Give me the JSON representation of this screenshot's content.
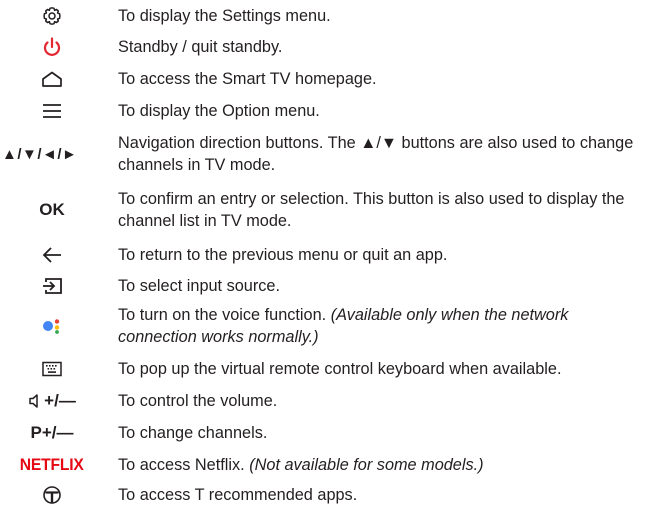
{
  "items": [
    {
      "icon": "settings-gear-icon",
      "text": "To display the Settings menu."
    },
    {
      "icon": "power-icon",
      "text": "Standby / quit standby."
    },
    {
      "icon": "home-icon",
      "text": "To access the Smart TV homepage."
    },
    {
      "icon": "menu-lines-icon",
      "text": "To display the Option menu."
    },
    {
      "icon": "navigation-arrows-icon",
      "symbol": "▲/▼/◄/►",
      "text": "Navigation direction buttons. The ▲/▼ buttons are also used to change channels in TV mode."
    },
    {
      "icon": "ok-button-icon",
      "symbol": "OK",
      "text": "To confirm an entry or selection. This button is also used to display the channel list in TV mode."
    },
    {
      "icon": "back-arrow-icon",
      "text": "To return to the previous menu or quit an app."
    },
    {
      "icon": "input-source-icon",
      "text": "To select input source."
    },
    {
      "icon": "voice-assistant-icon",
      "text": "To turn on the voice function. ",
      "note": "(Available only when the network connection works normally.)"
    },
    {
      "icon": "keyboard-icon",
      "text": "To pop up the virtual remote control keyboard when available."
    },
    {
      "icon": "volume-icon",
      "symbol": "+/—",
      "text": "To control the volume."
    },
    {
      "icon": "channel-icon",
      "symbol": "P",
      "text": "To change channels."
    },
    {
      "icon": "netflix-logo-icon",
      "symbol": "NETFLIX",
      "text": "To access Netflix. ",
      "note": "(Not available for some models.)"
    },
    {
      "icon": "t-apps-icon",
      "text": "To access T recommended apps."
    }
  ],
  "colors": {
    "text": "#231f20",
    "power": "#e3262f",
    "netflix": "#e50914",
    "voice_blue": "#4285f4",
    "voice_red": "#ea4335",
    "voice_yellow": "#fbbc05",
    "voice_green": "#34a853"
  }
}
